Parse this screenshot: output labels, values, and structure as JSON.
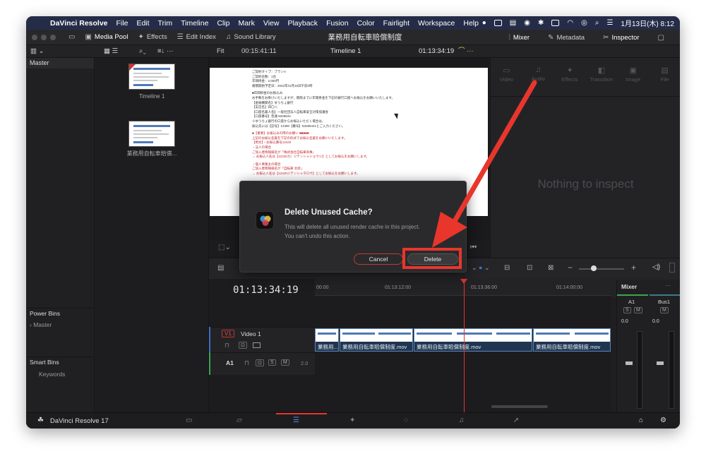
{
  "menubar": {
    "app": "DaVinci Resolve",
    "items": [
      "File",
      "Edit",
      "Trim",
      "Timeline",
      "Clip",
      "Mark",
      "View",
      "Playback",
      "Fusion",
      "Color",
      "Fairlight",
      "Workspace",
      "Help"
    ],
    "datetime": "1月13日(木) 8:12"
  },
  "toolbar": {
    "media_pool": "Media Pool",
    "effects": "Effects",
    "edit_index": "Edit Index",
    "sound_library": "Sound Library",
    "project_title": "業務用自転車賠償制度",
    "mixer": "Mixer",
    "metadata": "Metadata",
    "inspector": "Inspector"
  },
  "viewer_bar": {
    "zoom": "Fit",
    "source_timecode": "00:15:41:11",
    "timeline_name": "Timeline 1",
    "record_timecode": "01:13:34:19"
  },
  "left_panel": {
    "master": "Master",
    "power_bins": "Power Bins",
    "power_master": "Master",
    "smart_bins": "Smart Bins",
    "keywords": "Keywords"
  },
  "media_pool": {
    "clips": [
      {
        "name": "Timeline 1"
      },
      {
        "name": "業務用自転車賠償..."
      }
    ]
  },
  "inspector": {
    "tabs": [
      "Video",
      "Audio",
      "Effects",
      "Transition",
      "Image",
      "File"
    ],
    "empty_text": "Nothing to inspect"
  },
  "document": {
    "lines": [
      {
        "text": "ご契約タイプ：プランA",
        "red": false
      },
      {
        "text": "ご契約台数：1台",
        "red": false
      },
      {
        "text": "年間掛金：2,000円",
        "red": false
      },
      {
        "text": "補償開始予定日：2022年01月15日午前0時",
        "red": false
      },
      {
        "text": "■年間掛金のお振込み",
        "red": false
      },
      {
        "text": "お手数をお掛けいたしますが、期限までに年間掛金を下記の銀行口座へお振込をお願いいたします。",
        "red": false
      },
      {
        "text": "【金融機関名】ゆうちょ銀行",
        "red": false
      },
      {
        "text": "【支店名】四〇八",
        "red": false
      },
      {
        "text": "【口座名義人名】一般社団法人自転車安全対策協議会",
        "red": false
      },
      {
        "text": "【口座番号】普通 8328644",
        "red": false
      },
      {
        "text": "※ゆうちょ銀行の口座からお振込いただく場合は、",
        "red": false
      },
      {
        "text": "振込先には【記号】14380【番号】83286441とご入力ください。",
        "red": false
      },
      {
        "text": "■【重要】お振込みの際のお願い ■■■■■",
        "red": true
      },
      {
        "text": "上記のお振込名義を下記の形式でお振込名義をお願いいたします。",
        "red": true
      },
      {
        "text": "【例文】・お振込番号12340",
        "red": true
      },
      {
        "text": "・法人の場合",
        "red": true
      },
      {
        "text": "ご加入者情報様名が「株式会社自転車商事」",
        "red": true
      },
      {
        "text": "→ お振込人名は【12340カ）ジテンシャショウジ】としてお振込をお願いします。",
        "red": true
      },
      {
        "text": "・個人事業主の場合",
        "red": true
      },
      {
        "text": "ご加入者情報様名が「自転車 太郎」",
        "red": true
      },
      {
        "text": "→ お振込人名は【12340ジテンシャタロウ】としてお振込をお願いします。",
        "red": true
      }
    ]
  },
  "timeline": {
    "timecode": "01:13:34:19",
    "ruler": [
      "00:00",
      "01:13:12:00",
      "01:13:36:00",
      "01:14:00:00"
    ],
    "video_track": {
      "badge": "V1",
      "name": "Video 1"
    },
    "audio_track": {
      "name": "A1",
      "level": "2.0",
      "solo": "S",
      "mute": "M"
    },
    "clips": [
      {
        "name": "業務用..."
      },
      {
        "name": "業務用自転車賠償制度.mov"
      },
      {
        "name": "業務用自転車賠償制度.mov"
      },
      {
        "name": "業務用自転車賠償制度.mov"
      }
    ]
  },
  "mixer": {
    "title": "Mixer",
    "ch1": "A1",
    "ch2": "Bus1",
    "ch1_level": "0.0",
    "ch2_level": "0.0",
    "solo": "S",
    "mute": "M"
  },
  "status": {
    "app_version": "DaVinci Resolve 17"
  },
  "dialog": {
    "title": "Delete Unused Cache?",
    "body": "This will delete all unused render cache in this project. You can't undo this action.",
    "cancel": "Cancel",
    "delete": "Delete"
  },
  "colors": {
    "accent": "#e8362c",
    "menubar": "#252c47",
    "clip": "#5e84b9"
  }
}
